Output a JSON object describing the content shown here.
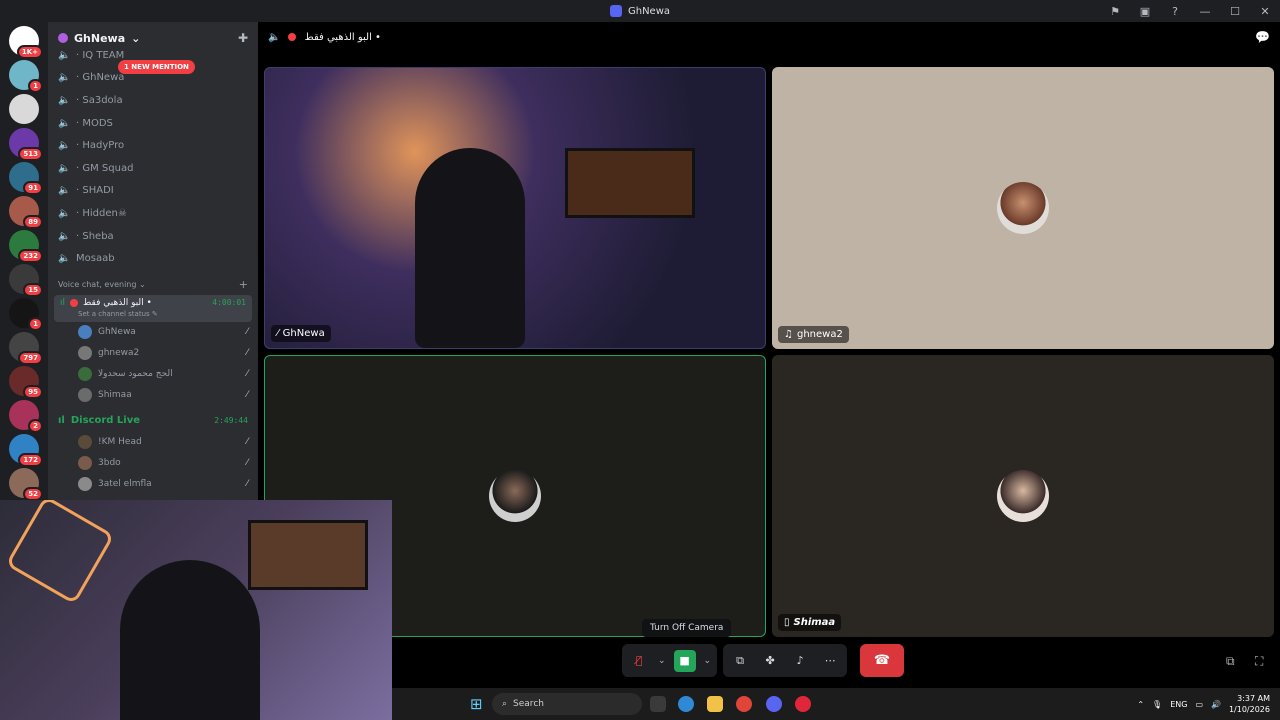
{
  "window": {
    "title": "GhNewa"
  },
  "servers": [
    {
      "badge": "1K+",
      "color": "#ffffff"
    },
    {
      "badge": "1",
      "color": "#6fb6c9"
    },
    {
      "badge": "",
      "color": "#d9d9d9"
    },
    {
      "badge": "513",
      "color": "#6b3aa8"
    },
    {
      "badge": "91",
      "color": "#2f6d8c"
    },
    {
      "badge": "89",
      "color": "#a85a4a"
    },
    {
      "badge": "232",
      "color": "#2c7a3d"
    },
    {
      "badge": "15",
      "color": "#3a3a3a"
    },
    {
      "badge": "1",
      "color": "#151515"
    },
    {
      "badge": "797",
      "color": "#444444"
    },
    {
      "badge": "95",
      "color": "#6a2a2a"
    },
    {
      "badge": "2",
      "color": "#a8325a"
    },
    {
      "badge": "172",
      "color": "#2f82c4"
    },
    {
      "badge": "52",
      "color": "#8c6a5a"
    },
    {
      "badge": "",
      "color": "#c98a3a"
    }
  ],
  "guild": {
    "name": "GhNewa"
  },
  "mention_pill": "1 NEW MENTION",
  "channels": [
    {
      "name": "· IQ TEAM",
      "partial": true
    },
    {
      "name": "· GhNewa"
    },
    {
      "name": "· Sa3dola"
    },
    {
      "name": "· MODS"
    },
    {
      "name": "· HadyPro"
    },
    {
      "name": "· GM Squad"
    },
    {
      "name": "· SHADI"
    },
    {
      "name": "· Hidden☠"
    },
    {
      "name": "· Sheba"
    },
    {
      "name": "Mosaab"
    }
  ],
  "category": {
    "name": "Voice chat, evening"
  },
  "active_voice": {
    "name": "البو الذهبي فقط •",
    "timer": "4:00:01",
    "status": "Set a channel status"
  },
  "voice_users": [
    {
      "name": "GhNewa",
      "color": "#4a7fbf"
    },
    {
      "name": "ghnewa2",
      "color": "#777777"
    },
    {
      "name": "الحج محمود سحدولا",
      "color": "#3a6b3a"
    },
    {
      "name": "Shimaa",
      "color": "#6b6b6b"
    }
  ],
  "live_channel": {
    "name": "Discord Live",
    "timer": "2:49:44"
  },
  "live_users": [
    {
      "name": "!KM Head",
      "color": "#5a4a3a"
    },
    {
      "name": "3bdo",
      "color": "#7a5a4a"
    },
    {
      "name": "3atel elmfla",
      "color": "#8a8a8a"
    }
  ],
  "topbar": {
    "channel": "البو الذهبي فقط •"
  },
  "tiles": [
    {
      "label": "GhNewa",
      "colors": {
        "bg": "#2a2a48"
      }
    },
    {
      "label": "ghnewa2",
      "colors": {
        "bg": "#bfb3a6"
      }
    },
    {
      "label": "",
      "colors": {
        "bg": "#1d1d1a"
      }
    },
    {
      "label": "Shimaa",
      "colors": {
        "bg": "#2a2622"
      }
    }
  ],
  "tooltip": "Turn Off Camera",
  "taskbar": {
    "search": "Search",
    "lang": "ENG",
    "time": "3:37 AM",
    "date": "1/10/2026"
  },
  "colors": {
    "danger": "#da373c",
    "online": "#23a55a",
    "blurple": "#5865f2"
  }
}
